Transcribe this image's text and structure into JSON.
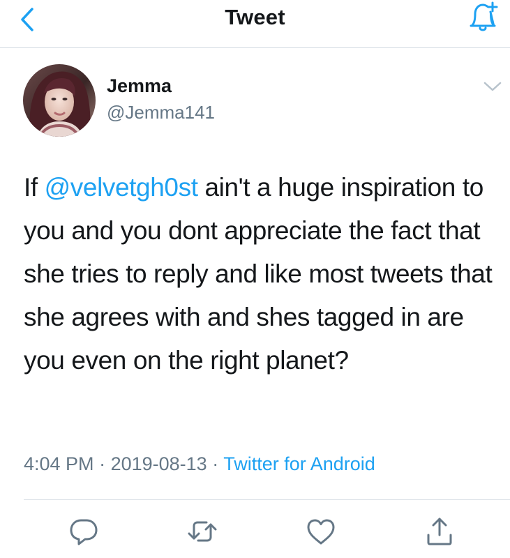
{
  "nav": {
    "title": "Tweet"
  },
  "author": {
    "name": "Jemma",
    "handle": "@Jemma141"
  },
  "tweet": {
    "text_before": "If ",
    "mention": "@velvetgh0st",
    "text_after": " ain't a huge inspiration to you and you dont appreciate the fact that she tries to reply and like most tweets that she agrees with and shes tagged in are you even on the right planet?"
  },
  "meta": {
    "time": "4:04 PM",
    "separator": " · ",
    "date": "2019-08-13",
    "source": "Twitter for Android"
  },
  "colors": {
    "accent": "#1da1f2",
    "secondary_text": "#657786",
    "divider": "#d6dde3",
    "icon_gray": "#657786"
  },
  "icons": {
    "back": "chevron-left-icon",
    "notify": "bell-plus-icon",
    "more": "chevron-down-icon",
    "reply": "reply-icon",
    "retweet": "retweet-icon",
    "like": "heart-icon",
    "share": "share-icon"
  }
}
